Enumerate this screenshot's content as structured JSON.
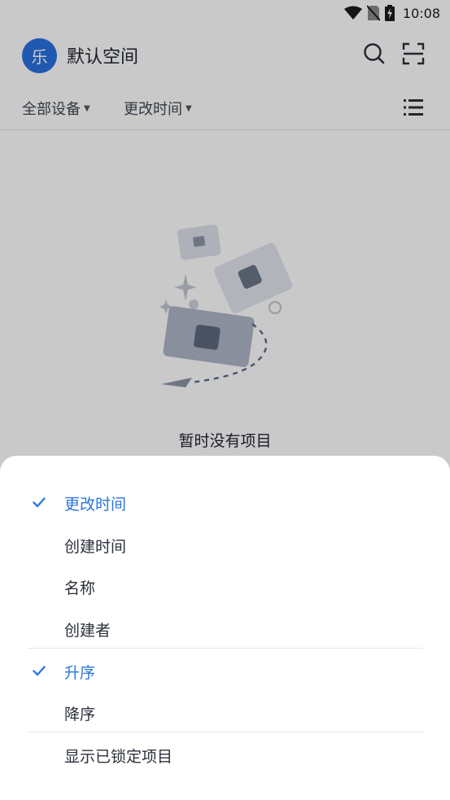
{
  "status_bar": {
    "time": "10:08"
  },
  "header": {
    "avatar_letter": "乐",
    "workspace_title": "默认空间"
  },
  "filters": {
    "devices": "全部设备",
    "sort": "更改时间"
  },
  "empty_state": {
    "text": "暂时没有项目"
  },
  "sort_sheet": {
    "sort_by": [
      {
        "label": "更改时间",
        "selected": true
      },
      {
        "label": "创建时间",
        "selected": false
      },
      {
        "label": "名称",
        "selected": false
      },
      {
        "label": "创建者",
        "selected": false
      }
    ],
    "order": [
      {
        "label": "升序",
        "selected": true
      },
      {
        "label": "降序",
        "selected": false
      }
    ],
    "show_locked": {
      "label": "显示已锁定项目"
    }
  },
  "colors": {
    "accent": "#2b77d9",
    "avatar": "#2b71e0",
    "scrim": "rgba(0,0,0,0.21)"
  }
}
